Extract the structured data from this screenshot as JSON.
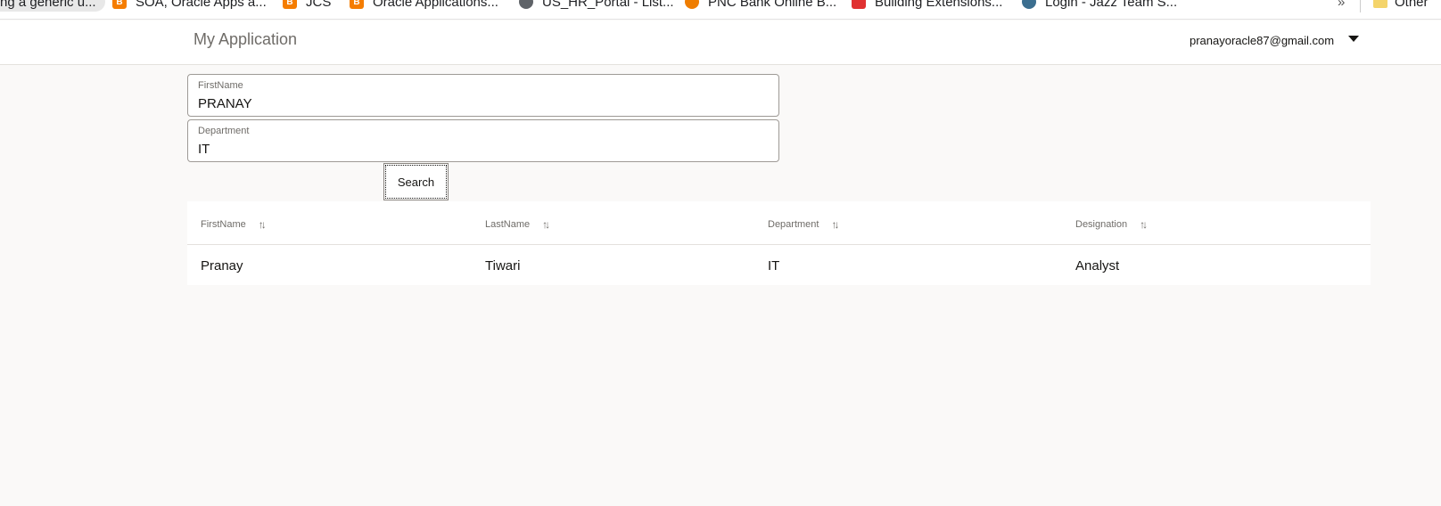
{
  "bookmarks": {
    "items": [
      {
        "label": "ng a generic u...",
        "icon": "globe-icon",
        "color": "#5f6368"
      },
      {
        "label": "SOA, Oracle Apps a...",
        "icon": "blogger-icon",
        "color": "#f57d00"
      },
      {
        "label": "JCS",
        "icon": "blogger-icon",
        "color": "#f57d00"
      },
      {
        "label": "Oracle Applications...",
        "icon": "blogger-icon",
        "color": "#f57d00"
      },
      {
        "label": "US_HR_Portal - List...",
        "icon": "globe-icon",
        "color": "#5f6368"
      },
      {
        "label": "PNC Bank Online B...",
        "icon": "pnc-icon",
        "color": "#ef7d00"
      },
      {
        "label": "Building Extensions...",
        "icon": "oracle-icon",
        "color": "#e03131"
      },
      {
        "label": "Login - Jazz Team S...",
        "icon": "jazz-icon",
        "color": "#3b6e8f"
      }
    ],
    "more": "»",
    "other": "Other"
  },
  "header": {
    "title": "My Application",
    "user_email": "pranayoracle87@gmail.com"
  },
  "form": {
    "first_name": {
      "label": "FirstName",
      "value": "PRANAY"
    },
    "department": {
      "label": "Department",
      "value": "IT"
    },
    "search_label": "Search"
  },
  "table": {
    "columns": [
      "FirstName",
      "LastName",
      "Department",
      "Designation"
    ],
    "rows": [
      [
        "Pranay",
        "Tiwari",
        "IT",
        "Analyst"
      ]
    ]
  }
}
